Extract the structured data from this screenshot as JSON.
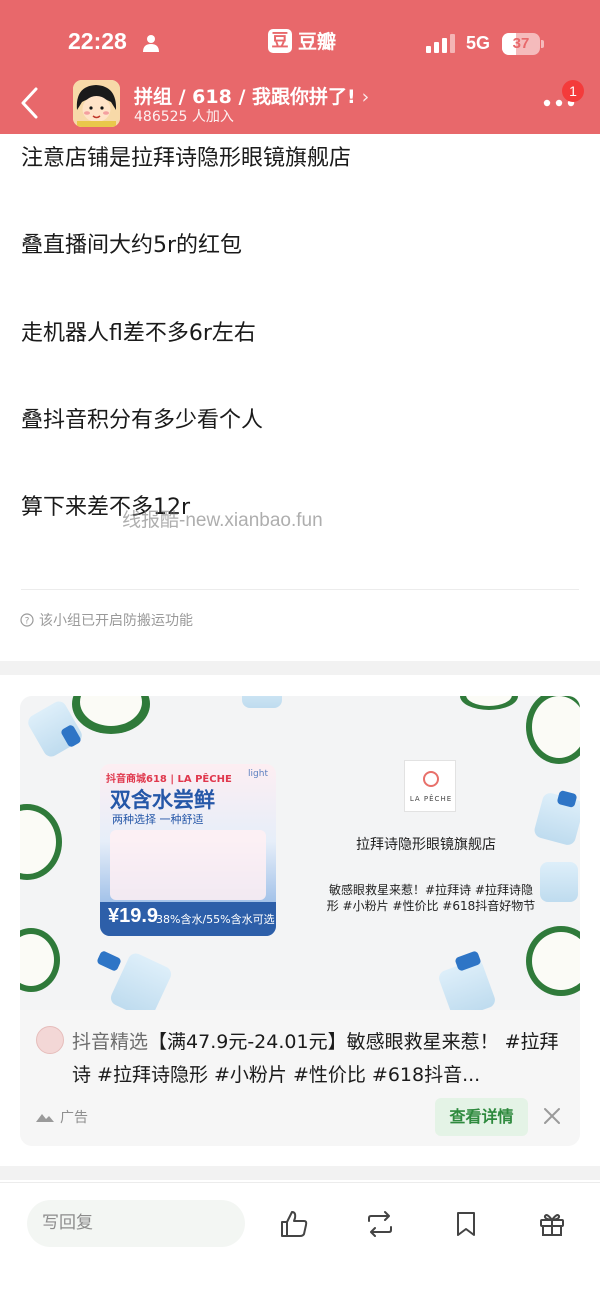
{
  "status_bar": {
    "time": "22:28",
    "app_name": "豆瓣",
    "app_logo": "豆",
    "network": "5G",
    "battery": "37",
    "battery_level": 0.37
  },
  "header": {
    "group_title": "拼组 / 618 / 我跟你拼了!",
    "chevron": "›",
    "members": "486525 人加入",
    "notification_count": "1",
    "bg_color": "#e8686b"
  },
  "post": {
    "lines": [
      "注意店铺是拉拜诗隐形眼镜旗舰店",
      "叠直播间大约5r的红包",
      "走机器人fl差不多6r左右",
      "叠抖音积分有多少看个人",
      "算下来差不多12r"
    ],
    "watermark": "线报酷-new.xianbao.fun",
    "protect_notice": "该小组已开启防搬运功能"
  },
  "ad": {
    "promo": {
      "top_tag": "抖音商城618 | LA PÊCHE",
      "light": "light",
      "title": "双含水尝鲜",
      "subtitle": "两种选择 一种舒适",
      "price": "¥19.9",
      "water": "38%含水/55%含水可选"
    },
    "brand_logo_text": "LA PÊCHE",
    "shop_name": "拉拜诗隐形眼镜旗舰店",
    "slogan": "敏感眼救星来惹！#拉拜诗 #拉拜诗隐形 #小粉片 #性价比 #618抖音好物节",
    "source": "抖音精选",
    "text": "【满47.9元-24.01元】敏感眼救星来惹！ #拉拜诗 #拉拜诗隐形 #小粉片 #性价比 #618抖音...",
    "label": "广告",
    "detail_button": "查看详情"
  },
  "bottom_bar": {
    "reply_placeholder": "写回复",
    "icons": [
      "like-icon",
      "repost-icon",
      "bookmark-icon",
      "gift-icon"
    ]
  }
}
